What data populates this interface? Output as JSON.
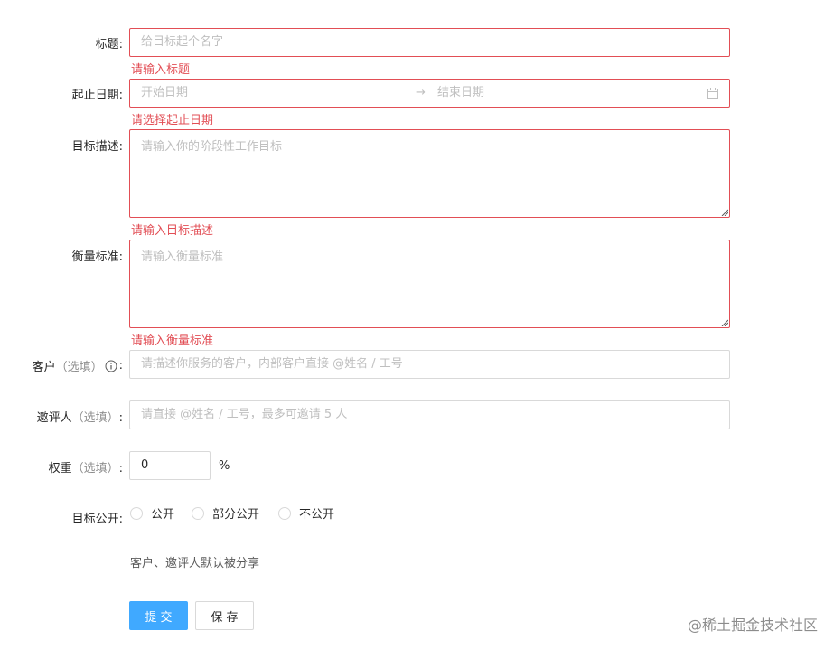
{
  "form": {
    "title": {
      "label": "标题:",
      "placeholder": "给目标起个名字",
      "error": "请输入标题"
    },
    "dates": {
      "label": "起止日期:",
      "start_placeholder": "开始日期",
      "separator": "→",
      "end_placeholder": "结束日期",
      "error": "请选择起止日期",
      "icon": "calendar-icon"
    },
    "description": {
      "label": "目标描述:",
      "placeholder": "请输入你的阶段性工作目标",
      "error": "请输入目标描述"
    },
    "standard": {
      "label": "衡量标准:",
      "placeholder": "请输入衡量标准",
      "error": "请输入衡量标准"
    },
    "client": {
      "label_main": "客户",
      "label_opt": "（选填）",
      "label_colon": ":",
      "placeholder": "请描述你服务的客户，内部客户直接 @姓名 / 工号",
      "icon": "info-circle-icon"
    },
    "reviewer": {
      "label_main": "邀评人",
      "label_opt": "（选填）",
      "label_colon": ":",
      "placeholder": "请直接 @姓名 / 工号，最多可邀请 5 人"
    },
    "weight": {
      "label_main": "权重",
      "label_opt": "（选填）",
      "label_colon": ":",
      "value": "0",
      "unit": "%"
    },
    "visibility": {
      "label": "目标公开:",
      "options": [
        "公开",
        "部分公开",
        "不公开"
      ],
      "hint": "客户、邀评人默认被分享"
    }
  },
  "buttons": {
    "submit": "提交",
    "save": "保存"
  },
  "watermark": "@稀土掘金技术社区",
  "colors": {
    "error": "#e24e55",
    "primary": "#40a9ff",
    "border": "#d9d9d9"
  }
}
